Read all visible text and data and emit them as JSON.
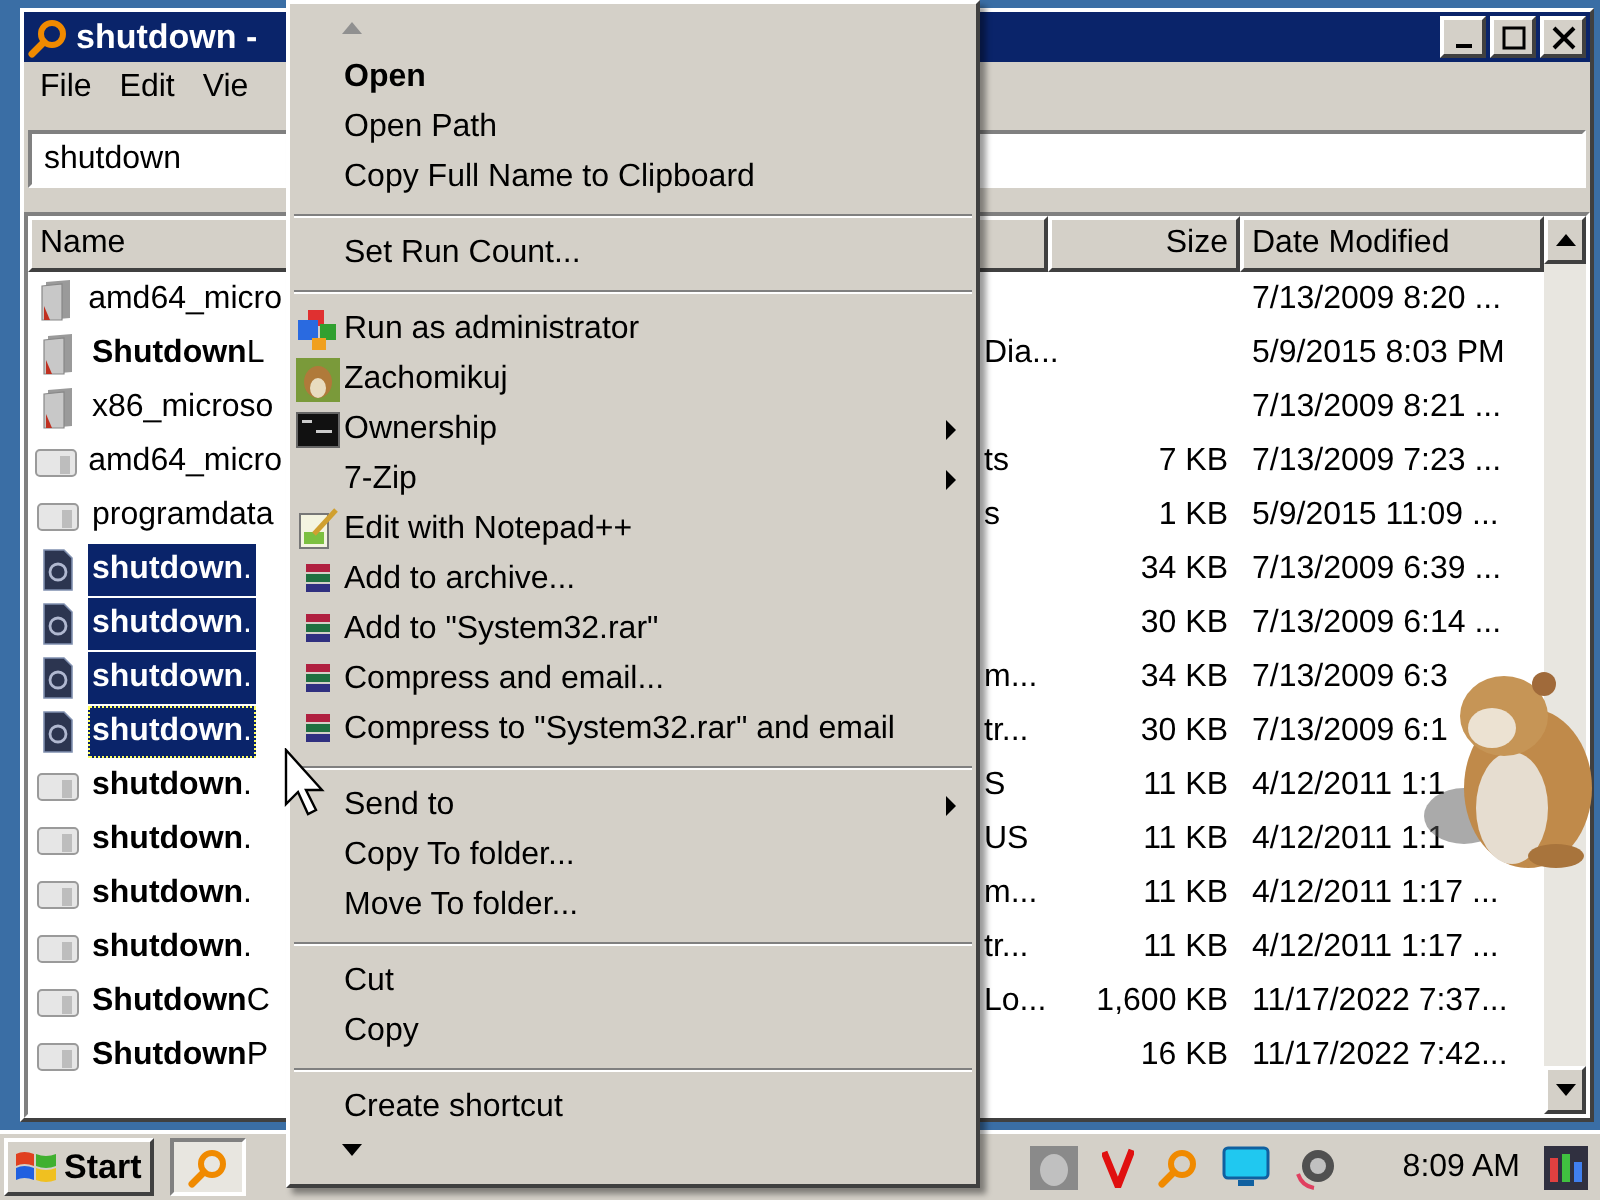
{
  "window": {
    "title": "shutdown -"
  },
  "menu_bar": [
    "File",
    "Edit",
    "Vie"
  ],
  "search": {
    "value": "shutdown"
  },
  "columns": [
    {
      "label": "Name"
    },
    {
      "label": "Size"
    },
    {
      "label": "Date Modified"
    }
  ],
  "rows": [
    {
      "kind": "manifest",
      "name": "amd64_micro",
      "date": "7/13/2009 8:20 ...",
      "selected": false,
      "focused": false
    },
    {
      "kind": "manifest",
      "name": "**Shutdown**L",
      "column_2": "Dia...",
      "date": "5/9/2015 8:03 PM",
      "selected": false,
      "focused": false
    },
    {
      "kind": "manifest",
      "name": "x86_microso",
      "date": "7/13/2009 8:21 ...",
      "selected": false,
      "focused": false
    },
    {
      "kind": "file",
      "name": "amd64_micro",
      "column_2": "ts",
      "size": "7 KB",
      "date": "7/13/2009 7:23 ...",
      "selected": false,
      "focused": false
    },
    {
      "kind": "file",
      "name": "programdata",
      "column_2": "s",
      "size": "1 KB",
      "date": "5/9/2015 11:09 ...",
      "selected": false,
      "focused": false
    },
    {
      "kind": "exe",
      "name": "**shutdown**.",
      "size": "34 KB",
      "date": "7/13/2009 6:39 ...",
      "selected": true,
      "focused": false
    },
    {
      "kind": "exe",
      "name": "**shutdown**.",
      "size": "30 KB",
      "date": "7/13/2009 6:14 ...",
      "selected": true,
      "focused": false
    },
    {
      "kind": "exe",
      "name": "**shutdown**.",
      "column_2": "m...",
      "size": "34 KB",
      "date": "7/13/2009 6:3",
      "selected": true,
      "focused": false
    },
    {
      "kind": "exe",
      "name": "**shutdown**.",
      "column_2": "tr...",
      "size": "30 KB",
      "date": "7/13/2009 6:1",
      "selected": true,
      "focused": true
    },
    {
      "kind": "file",
      "name": "**shutdown**.",
      "column_2": "S",
      "size": "11 KB",
      "date": "4/12/2011 1:1",
      "selected": false,
      "focused": false
    },
    {
      "kind": "file",
      "name": "**shutdown**.",
      "column_2": "US",
      "size": "11 KB",
      "date": "4/12/2011 1:1",
      "selected": false,
      "focused": false
    },
    {
      "kind": "file",
      "name": "**shutdown**.",
      "column_2": "m...",
      "size": "11 KB",
      "date": "4/12/2011 1:17 ...",
      "selected": false,
      "focused": false
    },
    {
      "kind": "file",
      "name": "**shutdown**.",
      "column_2": "tr...",
      "size": "11 KB",
      "date": "4/12/2011 1:17 ...",
      "selected": false,
      "focused": false
    },
    {
      "kind": "file",
      "name": "**Shutdown**C",
      "column_2": "Lo...",
      "size": "1,600 KB",
      "date": "11/17/2022 7:37...",
      "selected": false,
      "focused": false
    },
    {
      "kind": "file",
      "name": "**Shutdown**P",
      "size": "16 KB",
      "date": "11/17/2022 7:42...",
      "selected": false,
      "focused": false
    }
  ],
  "context_menu": {
    "items": [
      {
        "kind": "plain",
        "label": "Open",
        "default": true,
        "submenu": false
      },
      {
        "kind": "plain",
        "label": "Open Path",
        "default": false,
        "submenu": false
      },
      {
        "kind": "plain",
        "label": "Copy Full Name to Clipboard",
        "default": false,
        "submenu": false
      },
      {
        "kind": "separator"
      },
      {
        "kind": "plain",
        "label": "Set Run Count...",
        "default": false,
        "submenu": false
      },
      {
        "kind": "separator"
      },
      {
        "kind": "admin",
        "label": "Run as administrator",
        "default": false,
        "submenu": false
      },
      {
        "kind": "hamster",
        "label": "Zachomikuj",
        "default": false,
        "submenu": false
      },
      {
        "kind": "console",
        "label": "Ownership",
        "default": false,
        "submenu": true
      },
      {
        "kind": "plain",
        "label": "7-Zip",
        "default": false,
        "submenu": true
      },
      {
        "kind": "notepad",
        "label": "Edit with Notepad++",
        "default": false,
        "submenu": false
      },
      {
        "kind": "rar",
        "label": "Add to archive...",
        "default": false,
        "submenu": false
      },
      {
        "kind": "rar",
        "label": "Add to \"System32.rar\"",
        "default": false,
        "submenu": false
      },
      {
        "kind": "rar",
        "label": "Compress and email...",
        "default": false,
        "submenu": false
      },
      {
        "kind": "rar",
        "label": "Compress to \"System32.rar\" and email",
        "default": false,
        "submenu": false
      },
      {
        "kind": "separator"
      },
      {
        "kind": "plain",
        "label": "Send to",
        "default": false,
        "submenu": true
      },
      {
        "kind": "plain",
        "label": "Copy To folder...",
        "default": false,
        "submenu": false
      },
      {
        "kind": "plain",
        "label": "Move To folder...",
        "default": false,
        "submenu": false
      },
      {
        "kind": "separator"
      },
      {
        "kind": "plain",
        "label": "Cut",
        "default": false,
        "submenu": false
      },
      {
        "kind": "plain",
        "label": "Copy",
        "default": false,
        "submenu": false
      },
      {
        "kind": "separator"
      },
      {
        "kind": "plain",
        "label": "Create shortcut",
        "default": false,
        "submenu": false
      }
    ]
  },
  "taskbar": {
    "start": "Start",
    "clock": "8:09 AM"
  }
}
